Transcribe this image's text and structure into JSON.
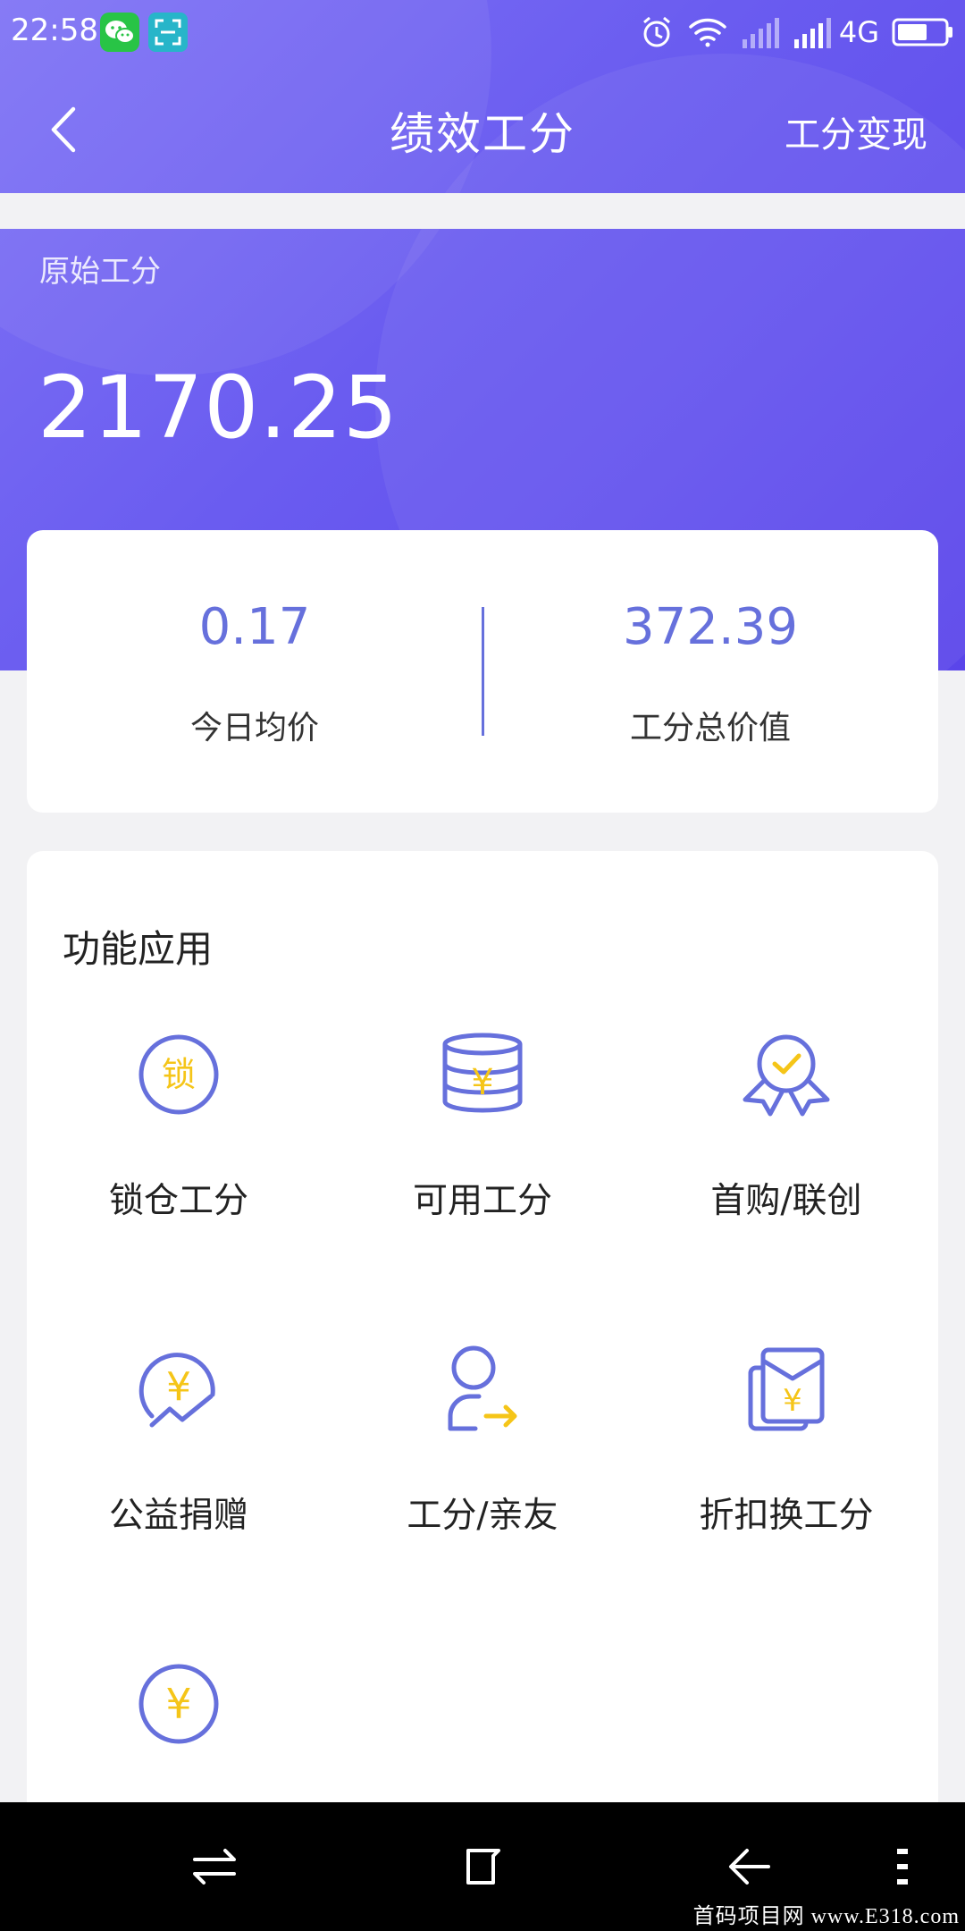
{
  "status_bar": {
    "time": "22:58",
    "network": "4G",
    "icons": [
      "wechat-icon",
      "scan-icon",
      "alarm-icon",
      "wifi-icon",
      "signal-icon",
      "battery-icon"
    ]
  },
  "header": {
    "title": "绩效工分",
    "right_link": "工分变现",
    "back_icon": "chevron-left-icon"
  },
  "summary": {
    "label": "原始工分",
    "value": "2170.25"
  },
  "stats": [
    {
      "value": "0.17",
      "label": "今日均价"
    },
    {
      "value": "372.39",
      "label": "工分总价值"
    }
  ],
  "functions": {
    "title": "功能应用",
    "items": [
      {
        "label": "锁仓工分",
        "icon": "lock-coin-icon",
        "icon_char": "锁"
      },
      {
        "label": "可用工分",
        "icon": "coin-stack-icon",
        "icon_char": "¥"
      },
      {
        "label": "首购/联创",
        "icon": "award-badge-icon"
      },
      {
        "label": "公益捐赠",
        "icon": "donation-icon",
        "icon_char": "¥"
      },
      {
        "label": "工分/亲友",
        "icon": "user-transfer-icon"
      },
      {
        "label": "折扣换工分",
        "icon": "red-envelope-icon",
        "icon_char": "¥"
      },
      {
        "label": "",
        "icon": "yuan-coin-icon",
        "icon_char": "¥"
      }
    ]
  },
  "colors": {
    "accent": "#6670dc",
    "icon_yellow": "#f5c518",
    "header_start": "#7f73f5",
    "header_end": "#5a45ea"
  },
  "system_nav": {
    "icons": [
      "switch-icon",
      "home-square-icon",
      "back-arrow-icon",
      "menu-dots-icon"
    ]
  },
  "watermark": "首码项目网 www.E318.com"
}
